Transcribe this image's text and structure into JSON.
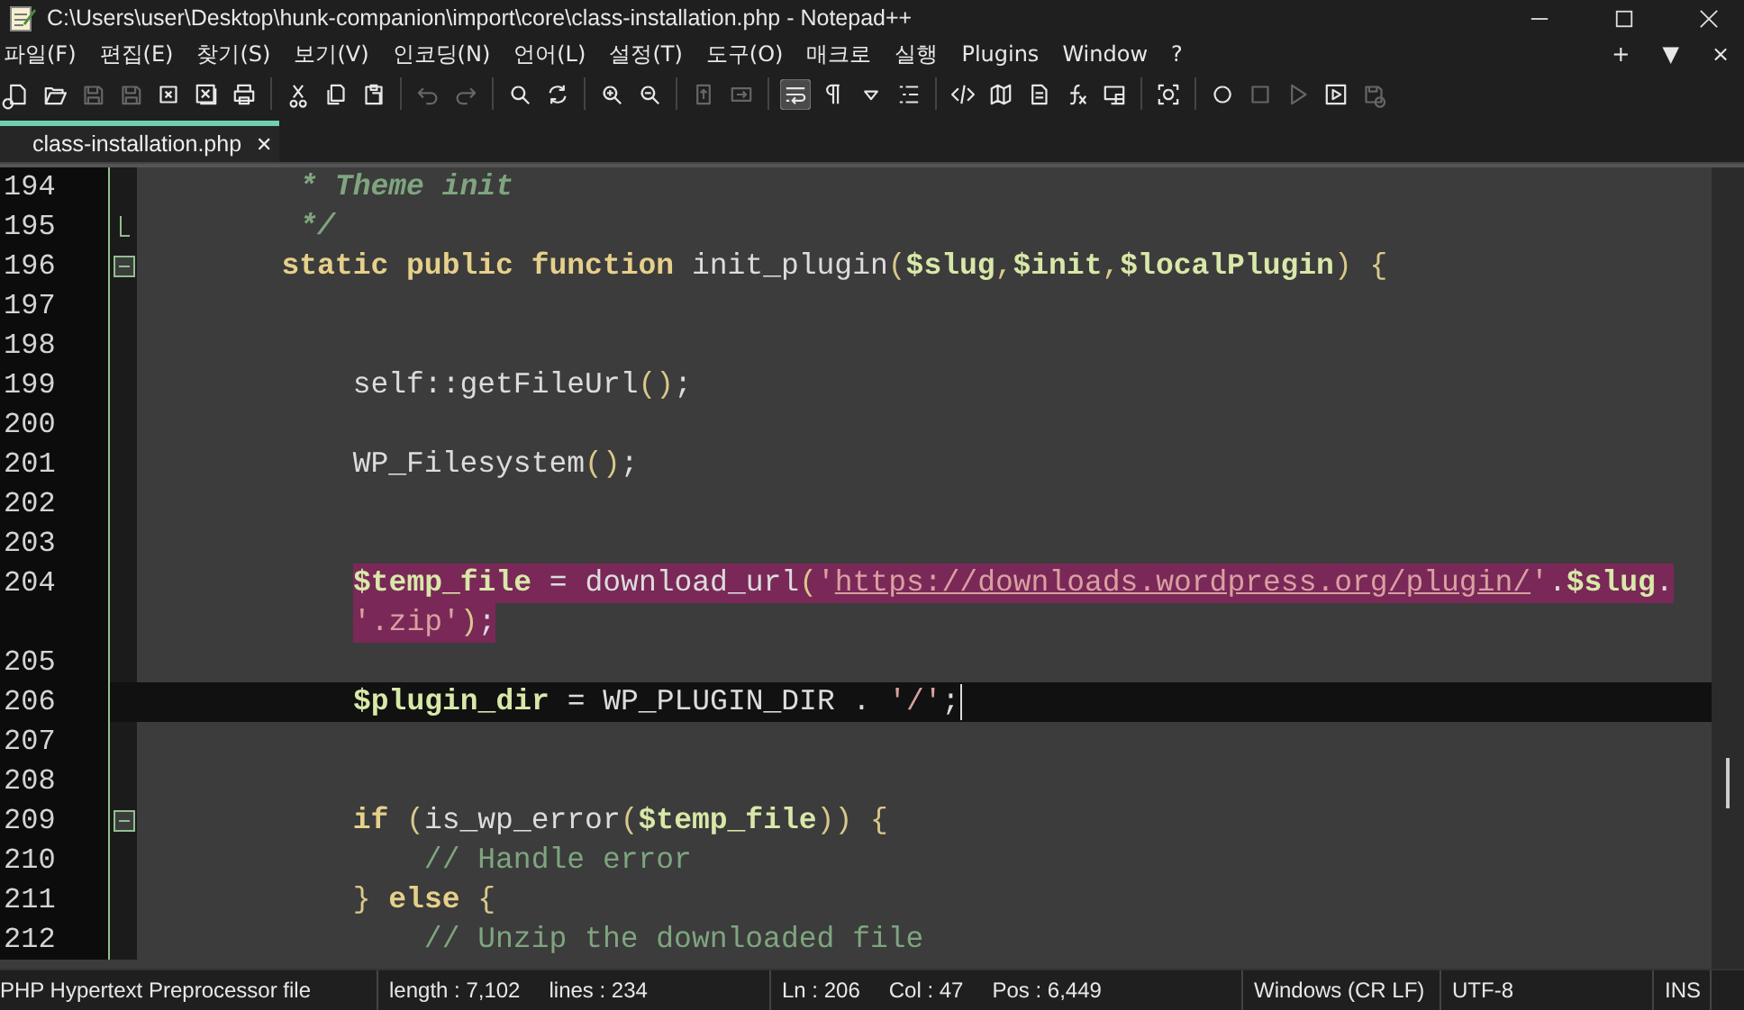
{
  "window": {
    "title": "C:\\Users\\user\\Desktop\\hunk-companion\\import\\core\\class-installation.php - Notepad++"
  },
  "menu": [
    "파일(F)",
    "편집(E)",
    "찾기(S)",
    "보기(V)",
    "인코딩(N)",
    "언어(L)",
    "설정(T)",
    "도구(O)",
    "매크로",
    "실행",
    "Plugins",
    "Window",
    "?"
  ],
  "menu_right": [
    "+",
    "▼",
    "×"
  ],
  "toolbar_groups": [
    [
      {
        "disabled": false,
        "pressed": false
      },
      {
        "disabled": false,
        "pressed": false
      },
      {
        "disabled": true,
        "pressed": false
      },
      {
        "disabled": true,
        "pressed": false
      },
      {
        "disabled": false,
        "pressed": false
      },
      {
        "disabled": false,
        "pressed": false
      },
      {
        "disabled": false,
        "pressed": false
      }
    ],
    [
      {
        "disabled": false,
        "pressed": false
      },
      {
        "disabled": false,
        "pressed": false
      },
      {
        "disabled": false,
        "pressed": false
      }
    ],
    [
      {
        "disabled": true,
        "pressed": false
      },
      {
        "disabled": true,
        "pressed": false
      }
    ],
    [
      {
        "disabled": false,
        "pressed": false
      },
      {
        "disabled": false,
        "pressed": false
      }
    ],
    [
      {
        "disabled": false,
        "pressed": false
      },
      {
        "disabled": false,
        "pressed": false
      }
    ],
    [
      {
        "disabled": true,
        "pressed": false
      },
      {
        "disabled": true,
        "pressed": false
      }
    ],
    [
      {
        "disabled": false,
        "pressed": true
      },
      {
        "disabled": false,
        "pressed": false
      },
      {
        "disabled": false,
        "pressed": false
      },
      {
        "disabled": false,
        "pressed": false
      }
    ],
    [
      {
        "disabled": false,
        "pressed": false
      },
      {
        "disabled": false,
        "pressed": false
      },
      {
        "disabled": false,
        "pressed": false
      },
      {
        "disabled": false,
        "pressed": false
      },
      {
        "disabled": false,
        "pressed": false
      }
    ],
    [
      {
        "disabled": false,
        "pressed": false
      }
    ],
    [
      {
        "disabled": false,
        "pressed": false
      },
      {
        "disabled": true,
        "pressed": false
      },
      {
        "disabled": true,
        "pressed": false
      },
      {
        "disabled": false,
        "pressed": false
      },
      {
        "disabled": true,
        "pressed": false
      }
    ]
  ],
  "tabs": [
    {
      "label": "class-installation.php",
      "selected": true,
      "close": "✕"
    }
  ],
  "lines": [
    {
      "number": "194",
      "fold_toggle": false,
      "fold_end": false,
      "current": false,
      "segments": [
        {
          "kind": "doc-comment",
          "text": "         * Theme init"
        }
      ]
    },
    {
      "number": "195",
      "fold_toggle": false,
      "fold_end": true,
      "current": false,
      "segments": [
        {
          "kind": "doc-comment",
          "text": "         */"
        }
      ]
    },
    {
      "number": "196",
      "fold_toggle": true,
      "fold_end": false,
      "current": false,
      "segments": [
        {
          "kind": "keyword",
          "text": "        static public function"
        },
        {
          "kind": "plain",
          "text": " init_plugin"
        },
        {
          "kind": "punct",
          "text": "("
        },
        {
          "kind": "variable",
          "text": "$slug"
        },
        {
          "kind": "punct",
          "text": ","
        },
        {
          "kind": "variable",
          "text": "$init"
        },
        {
          "kind": "punct",
          "text": ","
        },
        {
          "kind": "variable",
          "text": "$localPlugin"
        },
        {
          "kind": "punct",
          "text": ") {"
        }
      ]
    },
    {
      "number": "197",
      "fold_toggle": false,
      "fold_end": false,
      "current": false
    },
    {
      "number": "198",
      "fold_toggle": false,
      "fold_end": false,
      "current": false
    },
    {
      "number": "199",
      "fold_toggle": false,
      "fold_end": false,
      "current": false,
      "segments": [
        {
          "kind": "plain",
          "text": "            self::getFileUrl"
        },
        {
          "kind": "punct",
          "text": "()"
        },
        {
          "kind": "plain",
          "text": ";"
        }
      ]
    },
    {
      "number": "200",
      "fold_toggle": false,
      "fold_end": false,
      "current": false
    },
    {
      "number": "201",
      "fold_toggle": false,
      "fold_end": false,
      "current": false,
      "segments": [
        {
          "kind": "plain",
          "text": "            WP_Filesystem"
        },
        {
          "kind": "punct",
          "text": "()"
        },
        {
          "kind": "plain",
          "text": ";"
        }
      ]
    },
    {
      "number": "202",
      "fold_toggle": false,
      "fold_end": false,
      "current": false
    },
    {
      "number": "203",
      "fold_toggle": false,
      "fold_end": false,
      "current": false
    },
    {
      "number": "204",
      "fold_toggle": false,
      "fold_end": false,
      "current": false,
      "segments": [
        {
          "kind": "variable",
          "text": "$temp_file",
          "mark": true
        },
        {
          "kind": "plain",
          "text": " = download_url",
          "mark": true
        },
        {
          "kind": "punct",
          "text": "(",
          "mark": true
        },
        {
          "kind": "string",
          "text": "'",
          "mark": true
        },
        {
          "kind": "url",
          "text": "https://downloads.wordpress.org/plugin/",
          "mark": true
        },
        {
          "kind": "string",
          "text": "'",
          "mark": true
        },
        {
          "kind": "plain",
          "text": ".",
          "mark": true
        },
        {
          "kind": "variable",
          "text": "$slug",
          "mark": true
        },
        {
          "kind": "plain",
          "text": ".",
          "mark": true
        }
      ],
      "continuation": [
        {
          "kind": "string",
          "text": "'.zip'",
          "mark": true
        },
        {
          "kind": "punct",
          "text": ")",
          "mark": true
        },
        {
          "kind": "plain",
          "text": ";",
          "mark": true
        }
      ]
    },
    {
      "number": "205",
      "fold_toggle": false,
      "fold_end": false,
      "current": false
    },
    {
      "number": "206",
      "fold_toggle": false,
      "fold_end": false,
      "current": true,
      "segments": [
        {
          "kind": "variable",
          "text": "$plugin_dir",
          "mark": false
        },
        {
          "kind": "plain",
          "text": " = WP_PLUGIN_DIR . "
        },
        {
          "kind": "string",
          "text": "'/'"
        },
        {
          "kind": "plain",
          "text": ";"
        }
      ]
    },
    {
      "number": "207",
      "fold_toggle": false,
      "fold_end": false,
      "current": false
    },
    {
      "number": "208",
      "fold_toggle": false,
      "fold_end": false,
      "current": false
    },
    {
      "number": "209",
      "fold_toggle": true,
      "fold_end": false,
      "current": false,
      "segments": [
        {
          "kind": "keyword",
          "text": "            if"
        },
        {
          "kind": "punct",
          "text": " ("
        },
        {
          "kind": "plain",
          "text": "is_wp_error"
        },
        {
          "kind": "punct",
          "text": "("
        },
        {
          "kind": "variable",
          "text": "$temp_file"
        },
        {
          "kind": "punct",
          "text": ")) {"
        }
      ]
    },
    {
      "number": "210",
      "fold_toggle": false,
      "fold_end": false,
      "current": false,
      "segments": [
        {
          "kind": "comment",
          "text": "                // Handle error"
        }
      ]
    },
    {
      "number": "211",
      "fold_toggle": false,
      "fold_end": false,
      "current": false,
      "segments": [
        {
          "kind": "punct",
          "text": "            }"
        },
        {
          "kind": "keyword",
          "text": " else"
        },
        {
          "kind": "punct",
          "text": " {"
        }
      ]
    },
    {
      "number": "212",
      "fold_toggle": false,
      "fold_end": false,
      "current": false,
      "segments": [
        {
          "kind": "comment",
          "text": "                // Unzip the downloaded file"
        }
      ]
    }
  ],
  "status_bar": [
    [
      "PHP Hypertext Preprocessor file"
    ],
    [
      "length : 7,102",
      "lines : 234"
    ],
    [
      "Ln : 206",
      "Col : 47",
      "Pos : 6,449"
    ],
    [
      "Windows (CR LF)"
    ],
    [
      "UTF-8"
    ],
    [
      "INS"
    ]
  ]
}
